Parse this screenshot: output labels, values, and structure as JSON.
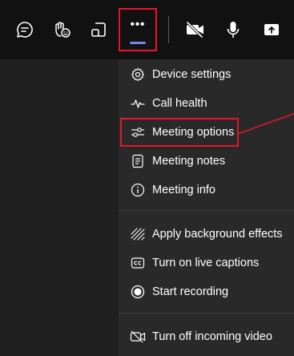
{
  "toolbar": {
    "buttons": [
      {
        "name": "chat",
        "icon": "chat-icon"
      },
      {
        "name": "react",
        "icon": "raise-hand-icon"
      },
      {
        "name": "view",
        "icon": "view-icon"
      },
      {
        "name": "more",
        "icon": "more-options-icon",
        "label": "•••"
      },
      {
        "name": "camera",
        "icon": "camera-off-icon"
      },
      {
        "name": "mic",
        "icon": "microphone-icon"
      },
      {
        "name": "share",
        "icon": "share-icon"
      }
    ]
  },
  "menu": {
    "items": [
      {
        "label": "Device settings",
        "icon": "gear-icon"
      },
      {
        "label": "Call health",
        "icon": "pulse-icon"
      },
      {
        "label": "Meeting options",
        "icon": "sliders-icon"
      },
      {
        "label": "Meeting notes",
        "icon": "notes-icon"
      },
      {
        "label": "Meeting info",
        "icon": "info-icon"
      },
      {
        "label": "Apply background effects",
        "icon": "background-effects-icon"
      },
      {
        "label": "Turn on live captions",
        "icon": "captions-icon"
      },
      {
        "label": "Start recording",
        "icon": "record-icon"
      },
      {
        "label": "Turn off incoming video",
        "icon": "video-off-icon"
      }
    ]
  },
  "colors": {
    "highlight": "#e8142b",
    "accent": "#7b83eb",
    "menu_bg": "#292929",
    "toolbar_bg": "#111111"
  }
}
